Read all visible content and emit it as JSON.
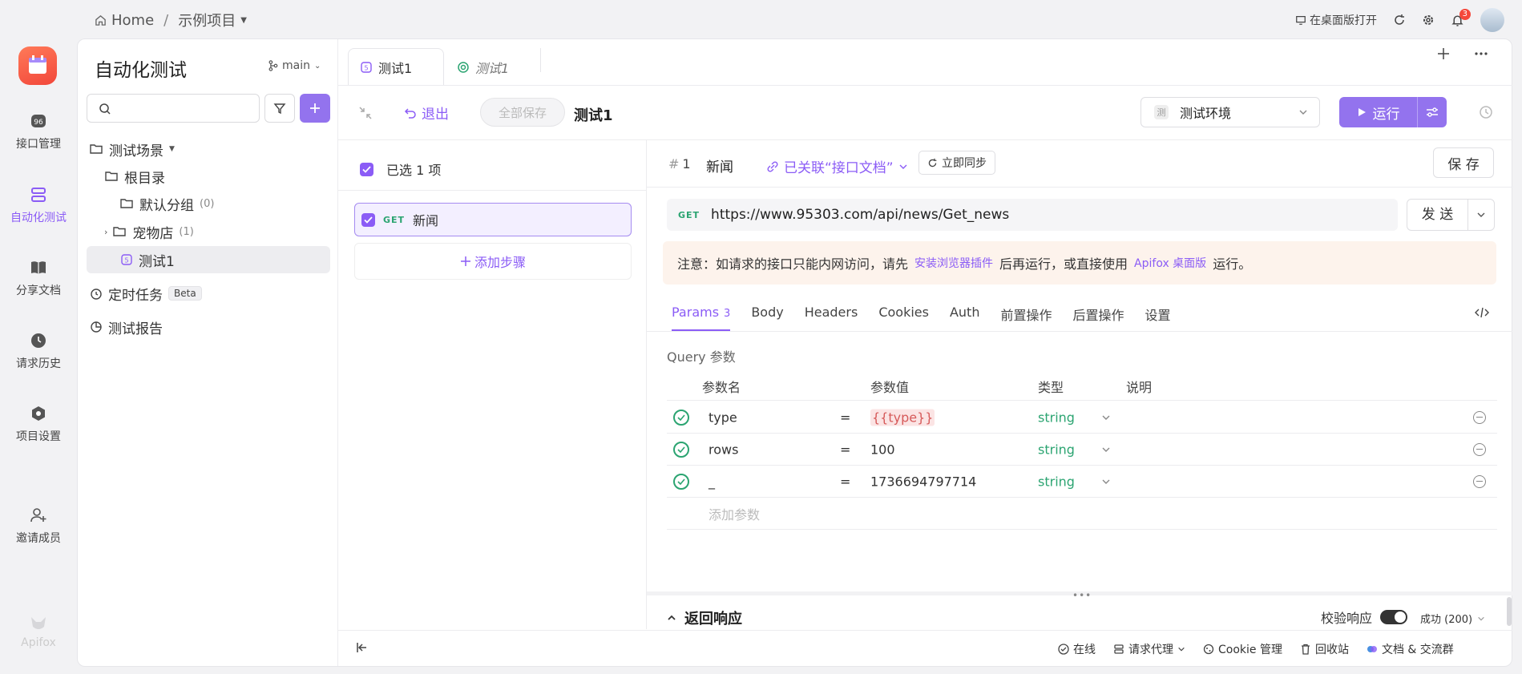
{
  "breadcrumb": {
    "home": "Home",
    "sep": "/",
    "project": "示例项目"
  },
  "topright": {
    "desktop_open": "在桌面版打开",
    "notification_count": "3"
  },
  "rail": {
    "items": [
      {
        "label": "接口管理",
        "icon": "api-icon"
      },
      {
        "label": "自动化测试",
        "icon": "automation-icon",
        "active": true
      },
      {
        "label": "分享文档",
        "icon": "book-icon"
      },
      {
        "label": "请求历史",
        "icon": "clock-icon"
      },
      {
        "label": "项目设置",
        "icon": "settings-icon"
      },
      {
        "label": "邀请成员",
        "icon": "add-user-icon"
      }
    ],
    "brand": "Apifox"
  },
  "tree": {
    "title": "自动化测试",
    "branch": "main",
    "scenarios": "测试场景",
    "root": "根目录",
    "default_group": "默认分组",
    "default_count": "(0)",
    "pet_shop": "宠物店",
    "pet_count": "(1)",
    "test1": "测试1",
    "scheduled": "定时任务",
    "beta": "Beta",
    "report": "测试报告"
  },
  "tabs": {
    "tab1": "测试1",
    "tab2": "测试1"
  },
  "toolbar": {
    "back": "退出",
    "save_all": "全部保存",
    "title": "测试1",
    "env": "测试环境",
    "env_icon": "测",
    "run": "运行"
  },
  "steps": {
    "selected": "已选 1 项",
    "step_method": "GET",
    "step_name": "新闻",
    "add_step": "添加步骤"
  },
  "request": {
    "index": "1",
    "name": "新闻",
    "linked": "已关联“接口文档”",
    "sync": "立即同步",
    "save": "保 存",
    "method": "GET",
    "url": "https://www.95303.com/api/news/Get_news",
    "send": "发 送"
  },
  "notice": {
    "text1": "注意：如请求的接口只能内网访问，请先",
    "link1": "安装浏览器插件",
    "text2": "后再运行，或直接使用",
    "link2": "Apifox 桌面版",
    "text3": "运行。"
  },
  "req_tabs": {
    "params": "Params",
    "params_count": "3",
    "body": "Body",
    "headers": "Headers",
    "cookies": "Cookies",
    "auth": "Auth",
    "pre": "前置操作",
    "post": "后置操作",
    "settings": "设置"
  },
  "query": {
    "title": "Query 参数",
    "headers": {
      "name": "参数名",
      "value": "参数值",
      "type": "类型",
      "desc": "说明"
    },
    "rows": [
      {
        "name": "type",
        "eq": "=",
        "value": "{{type}}",
        "type": "string"
      },
      {
        "name": "rows",
        "eq": "=",
        "value": "100",
        "type": "string"
      },
      {
        "name": "_",
        "eq": "=",
        "value": "1736694797714",
        "type": "string"
      }
    ],
    "add_param": "添加参数"
  },
  "response": {
    "title": "返回响应",
    "validate": "校验响应",
    "status": "成功 (200)"
  },
  "footer": {
    "online": "在线",
    "proxy": "请求代理",
    "cookie": "Cookie 管理",
    "trash": "回收站",
    "docs": "文档 & 交流群"
  }
}
